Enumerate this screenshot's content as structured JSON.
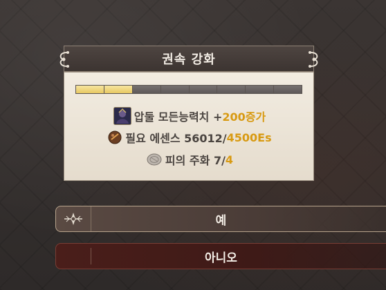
{
  "dialog": {
    "title": "권속 강화",
    "progress": {
      "filled": 2,
      "total": 8
    },
    "rows": [
      {
        "icon": "character-portrait-icon",
        "text": "압둘 모든능력치 + ",
        "value": "200증가"
      },
      {
        "icon": "essence-orb-icon",
        "text": "필요 에센스 56012/",
        "value": "4500Es"
      },
      {
        "icon": "blood-coin-icon",
        "text": "피의 주화 7/",
        "value": "4"
      }
    ]
  },
  "buttons": {
    "yes": "예",
    "no": "아니오"
  },
  "colors": {
    "accent_gold": "#d89a12",
    "progress_fill": "#e8c862",
    "panel_bg": "#ece4d6"
  }
}
